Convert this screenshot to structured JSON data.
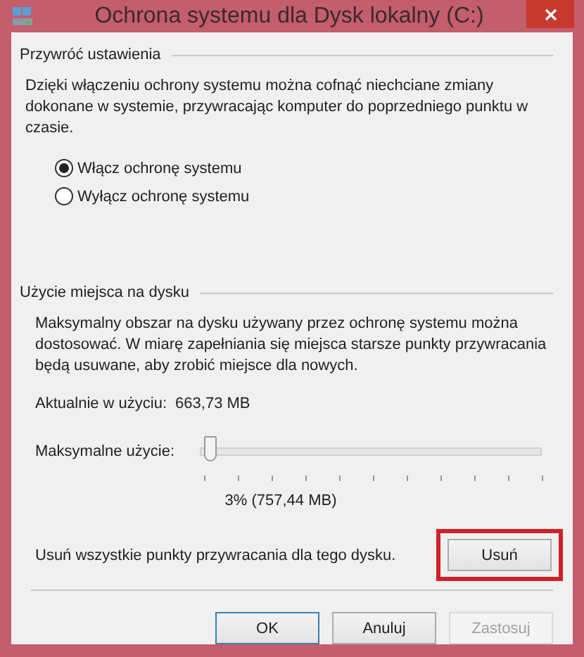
{
  "window": {
    "title": "Ochrona systemu dla Dysk lokalny (C:)"
  },
  "restore_settings": {
    "heading": "Przywróć ustawienia",
    "description": "Dzięki włączeniu ochrony systemu można cofnąć niechciane zmiany dokonane w systemie, przywracając komputer do poprzedniego punktu w czasie.",
    "options": [
      {
        "label": "Włącz ochronę systemu",
        "selected": true
      },
      {
        "label": "Wyłącz ochronę systemu",
        "selected": false
      }
    ]
  },
  "disk_usage": {
    "heading": "Użycie miejsca na dysku",
    "description": "Maksymalny obszar na dysku używany przez ochronę systemu można dostosować. W miarę zapełniania się miejsca starsze punkty przywracania będą usuwane, aby zrobić miejsce dla nowych.",
    "current_label": "Aktualnie w użyciu:",
    "current_value": "663,73 MB",
    "max_label": "Maksymalne użycie:",
    "max_slider": {
      "level": 0.03
    },
    "max_reading": "3% (757,44 MB)",
    "delete_text": "Usuń wszystkie punkty przywracania dla tego dysku.",
    "delete_button": {
      "label": "Usuń",
      "highlighted": true
    }
  },
  "buttons": [
    {
      "label": "OK",
      "disabled": false,
      "default": true
    },
    {
      "label": "Anuluj",
      "disabled": false,
      "default": false
    },
    {
      "label": "Zastosuj",
      "disabled": true,
      "default": false
    }
  ]
}
